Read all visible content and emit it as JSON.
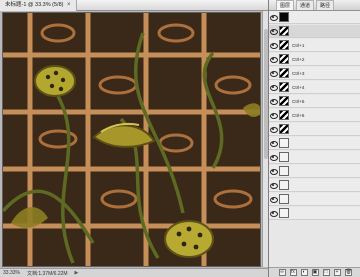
{
  "document": {
    "tab_title": "未标题-1 @ 33.3% (5/8)",
    "close_glyph": "×",
    "zoom": "33.33%",
    "info": "文档:1.37M/6.22M"
  },
  "panel": {
    "tabs": [
      "图层",
      "通道",
      "路径"
    ],
    "layers": [
      {
        "name": "",
        "thumb": "black",
        "selected": false
      },
      {
        "name": "",
        "thumb": "pattern",
        "selected": true
      },
      {
        "name": "Ctrl+1",
        "thumb": "pattern",
        "selected": false
      },
      {
        "name": "Ctrl+2",
        "thumb": "pattern",
        "selected": false
      },
      {
        "name": "Ctrl+3",
        "thumb": "pattern",
        "selected": false
      },
      {
        "name": "Ctrl+4",
        "thumb": "pattern",
        "selected": false
      },
      {
        "name": "Ctrl+5",
        "thumb": "pattern",
        "selected": false
      },
      {
        "name": "Ctrl+6",
        "thumb": "pattern",
        "selected": false
      },
      {
        "name": "",
        "thumb": "pattern",
        "selected": false
      },
      {
        "name": "",
        "thumb": "blank",
        "selected": false
      },
      {
        "name": "",
        "thumb": "blank",
        "selected": false
      },
      {
        "name": "",
        "thumb": "blank",
        "selected": false
      },
      {
        "name": "",
        "thumb": "blank",
        "selected": false
      },
      {
        "name": "",
        "thumb": "blank",
        "selected": false
      },
      {
        "name": "",
        "thumb": "blank",
        "selected": false
      }
    ],
    "tools": [
      "∞",
      "fx",
      "◐",
      "▣",
      "□",
      "+",
      "🗑"
    ]
  },
  "colors": {
    "canvas_bg": "#3a2818",
    "lattice": "#d69a61",
    "pods": "#b4a72f",
    "panel": "#e7e7e7"
  }
}
